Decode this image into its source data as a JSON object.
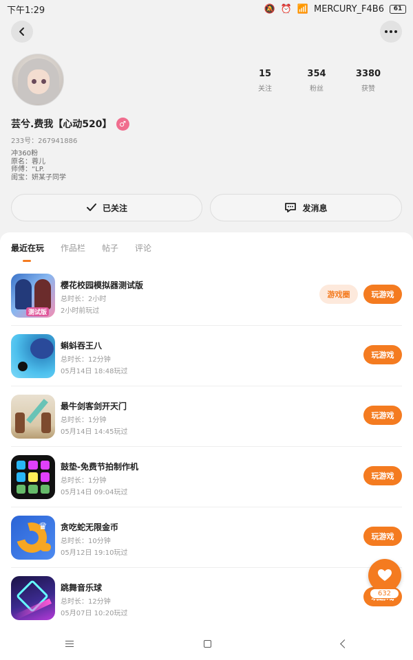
{
  "status_bar": {
    "time": "下午1:29",
    "network": "MERCURY_F4B6",
    "battery": "61"
  },
  "profile": {
    "stats": [
      {
        "value": "15",
        "label": "关注"
      },
      {
        "value": "354",
        "label": "粉丝"
      },
      {
        "value": "3380",
        "label": "获赞"
      }
    ],
    "username": "芸兮.费我【心动520】",
    "badge_glyph": "♂",
    "uid": "233号：267941886",
    "bio_lines": [
      "冲360粉",
      "原名：蓉儿",
      "师傅：“LP.",
      "闺宝：妍某子同学"
    ]
  },
  "actions": {
    "follow_label": "已关注",
    "message_label": "发消息"
  },
  "tabs": [
    {
      "label": "最近在玩",
      "active": true
    },
    {
      "label": "作品栏",
      "active": false
    },
    {
      "label": "帖子",
      "active": false
    },
    {
      "label": "评论",
      "active": false
    }
  ],
  "games": [
    {
      "name": "樱花校园模拟器测试版",
      "duration": "总时长：2小时",
      "last_played": "2小时前玩过",
      "icon": "sakura-school-icon",
      "icon_label": "测试版",
      "circle_label": "游戏圈",
      "play_label": "玩游戏"
    },
    {
      "name": "蝌蚪吞王八",
      "duration": "总时长：12分钟",
      "last_played": "05月14日 18:48玩过",
      "icon": "tadpole-icon",
      "play_label": "玩游戏"
    },
    {
      "name": "最牛剑客剑开天门",
      "duration": "总时长：1分钟",
      "last_played": "05月14日 14:45玩过",
      "icon": "sword-icon",
      "play_label": "玩游戏"
    },
    {
      "name": "鼓垫-免费节拍制作机",
      "duration": "总时长：1分钟",
      "last_played": "05月14日 09:04玩过",
      "icon": "drum-pad-icon",
      "play_label": "玩游戏"
    },
    {
      "name": "贪吃蛇无限金币",
      "duration": "总时长：10分钟",
      "last_played": "05月12日 19:10玩过",
      "icon": "snake-icon",
      "play_label": "玩游戏"
    },
    {
      "name": "跳舞音乐球",
      "duration": "总时长：12分钟",
      "last_played": "05月07日 10:20玩过",
      "icon": "dance-ball-icon",
      "play_label": "玩游戏"
    }
  ],
  "fab": {
    "count": "632"
  },
  "colors": {
    "accent": "#f47b20",
    "circle_bg": "#fde9dc",
    "badge": "#f06d8e"
  },
  "drum_pad_colors": [
    "#29b6f6",
    "#e040fb",
    "#e040fb",
    "#29b6f6",
    "#ffee58",
    "#e040fb",
    "#66bb6a",
    "#66bb6a",
    "#66bb6a"
  ]
}
